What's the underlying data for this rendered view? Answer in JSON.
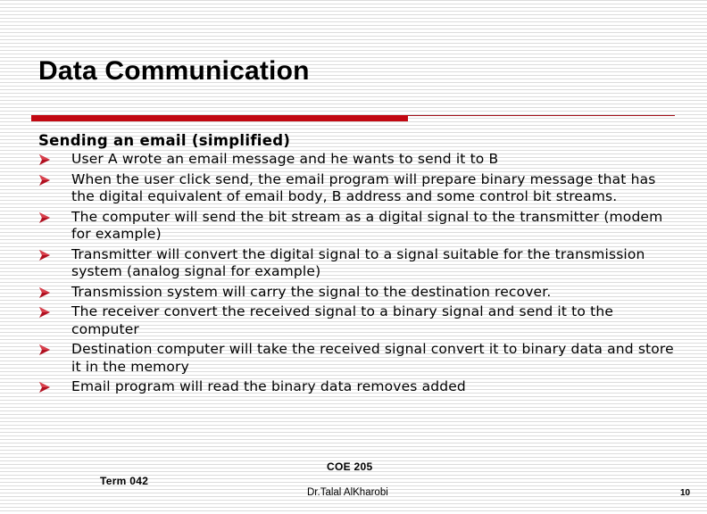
{
  "slide": {
    "title": "Data Communication",
    "subheading": "Sending an email (simplified)",
    "bullet_icon": "arrowhead-bullet-icon",
    "accent_color": "#c20812",
    "bullets": [
      {
        "text": "User A wrote an email message and he wants to send it to B"
      },
      {
        "text": "When the user click send, the email program will prepare binary message that has the digital equivalent of email body, B address and some control bit streams."
      },
      {
        "text": "The computer will send the bit stream as a digital signal to the transmitter (modem for example)"
      },
      {
        "text": "Transmitter will convert the digital signal to a signal suitable for the transmission system (analog signal for example)"
      },
      {
        "text": "Transmission system will carry the signal to the destination recover."
      },
      {
        "text": "The receiver convert the received signal to a binary signal and send it to the computer"
      },
      {
        "text": "Destination computer will take the received signal convert it to binary data and store it in the memory"
      },
      {
        "text": "Email program will read the binary data removes added"
      }
    ]
  },
  "footer": {
    "term": "Term 042",
    "course": "COE 205",
    "author": "Dr.Talal AlKharobi",
    "page_number": "10"
  }
}
